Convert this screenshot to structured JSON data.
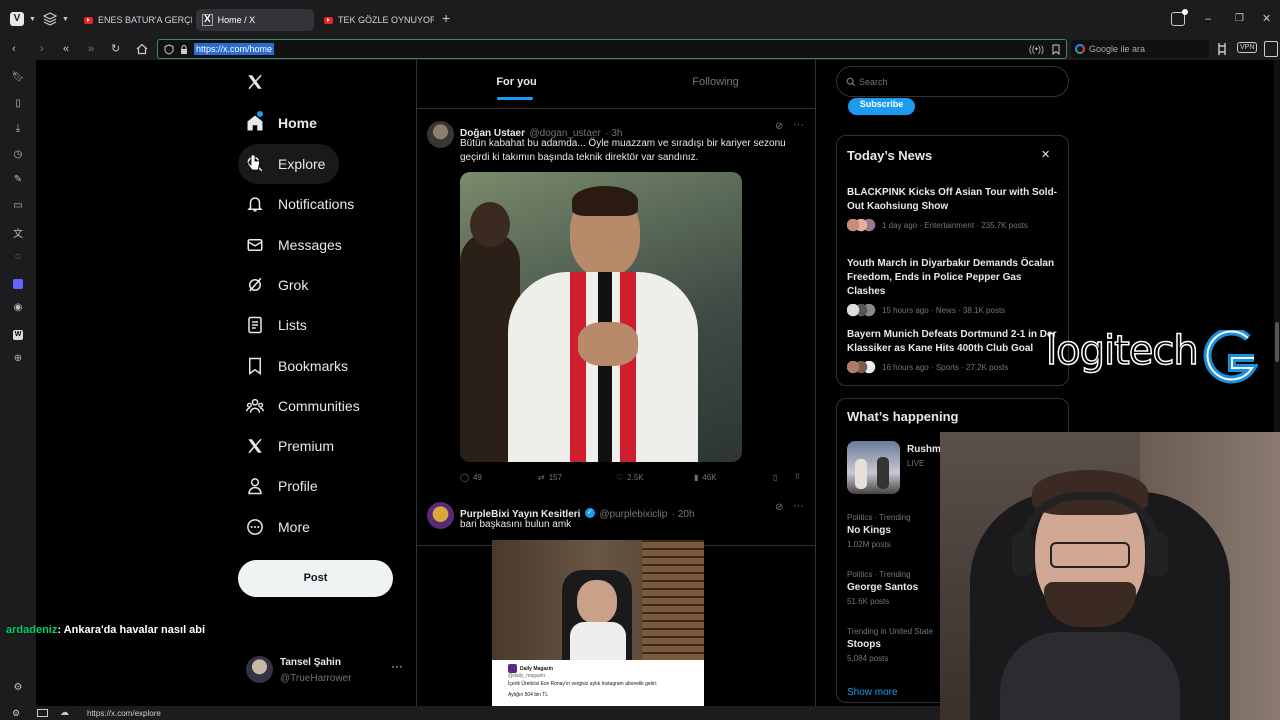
{
  "browser": {
    "tabs": [
      {
        "title": "ENES BATUR'A GERÇEKTEN"
      },
      {
        "title": "Home / X"
      },
      {
        "title": "TEK GÖZLE OYNUYOR VE B"
      }
    ],
    "url": "https://x.com/home",
    "search_placeholder": "Google ile ara",
    "vpn_label": "VPN",
    "status_url": "https://x.com/explore"
  },
  "nav": {
    "items": [
      {
        "label": "Home",
        "icon": "home-icon"
      },
      {
        "label": "Explore",
        "icon": "search-icon"
      },
      {
        "label": "Notifications",
        "icon": "bell-icon"
      },
      {
        "label": "Messages",
        "icon": "mail-icon"
      },
      {
        "label": "Grok",
        "icon": "grok-icon"
      },
      {
        "label": "Lists",
        "icon": "list-icon"
      },
      {
        "label": "Bookmarks",
        "icon": "bookmark-icon"
      },
      {
        "label": "Communities",
        "icon": "communities-icon"
      },
      {
        "label": "Premium",
        "icon": "x-logo-icon"
      },
      {
        "label": "Profile",
        "icon": "person-icon"
      },
      {
        "label": "More",
        "icon": "more-circle-icon"
      }
    ],
    "post_label": "Post",
    "user": {
      "name": "Tansel Şahin",
      "handle": "@TrueHarrower"
    }
  },
  "feed": {
    "tabs": [
      "For you",
      "Following"
    ],
    "tweets": [
      {
        "name": "Doğan Ustaer",
        "handle": "@dogan_ustaer",
        "time": "· 3h",
        "text": "Bütün kabahat bu adamda... Öyle muazzam ve sıradışı bir kariyer sezonu geçirdi ki takımın başında teknik direktör var sandınız.",
        "replies": "49",
        "reposts": "157",
        "likes": "2.5K",
        "views": "46K"
      },
      {
        "name": "PurpleBixi Yayın Kesitleri",
        "handle": "@purplebixiclip",
        "time": "· 20h",
        "text": "bari başkasını bulun amk",
        "embed_source": "Daily Magazin",
        "embed_handle": "@daily_magazin",
        "embed_text": "İçerik Üreticisi Ece Ronay'ın vergisiz aylık Instagram abonelik geliri:",
        "embed_text2": "Aylığın 504 bin TL"
      }
    ]
  },
  "right": {
    "search_placeholder": "Search",
    "subscribe_label": "Subscribe",
    "news_title": "Today’s News",
    "news": [
      {
        "headline": "BLACKPINK Kicks Off Asian Tour with Sold-Out Kaohsiung Show",
        "meta": "1 day ago · Entertainment · 235.7K posts"
      },
      {
        "headline": "Youth March in Diyarbakır Demands Öcalan Freedom, Ends in Police Pepper Gas Clashes",
        "meta": "15 hours ago · News · 38.1K posts"
      },
      {
        "headline": "Bayern Munich Defeats Dortmund 2-1 in Der Klassiker as Kane Hits 400th Club Goal",
        "meta": "16 hours ago · Sports · 27.2K posts"
      }
    ],
    "happening_title": "What’s happening",
    "live_title": "Rushm",
    "live_label": "LIVE",
    "trends": [
      {
        "context": "Politics · Trending",
        "name": "No Kings",
        "posts": "1.02M posts"
      },
      {
        "context": "Politics · Trending",
        "name": "George Santos",
        "posts": "51.6K posts"
      },
      {
        "context": "Trending in United State",
        "name": "Stoops",
        "posts": "5,084 posts"
      }
    ],
    "show_more": "Show more"
  },
  "overlay": {
    "chat_user": "ardadeniz",
    "chat_message": ": Ankara'da havalar nasıl abi",
    "logo_text": "logitech"
  },
  "colors": {
    "accent": "#1d9bf0",
    "bg": "#000000",
    "border": "#2f3336",
    "muted": "#71767b",
    "chat_user": "#00d26a"
  }
}
